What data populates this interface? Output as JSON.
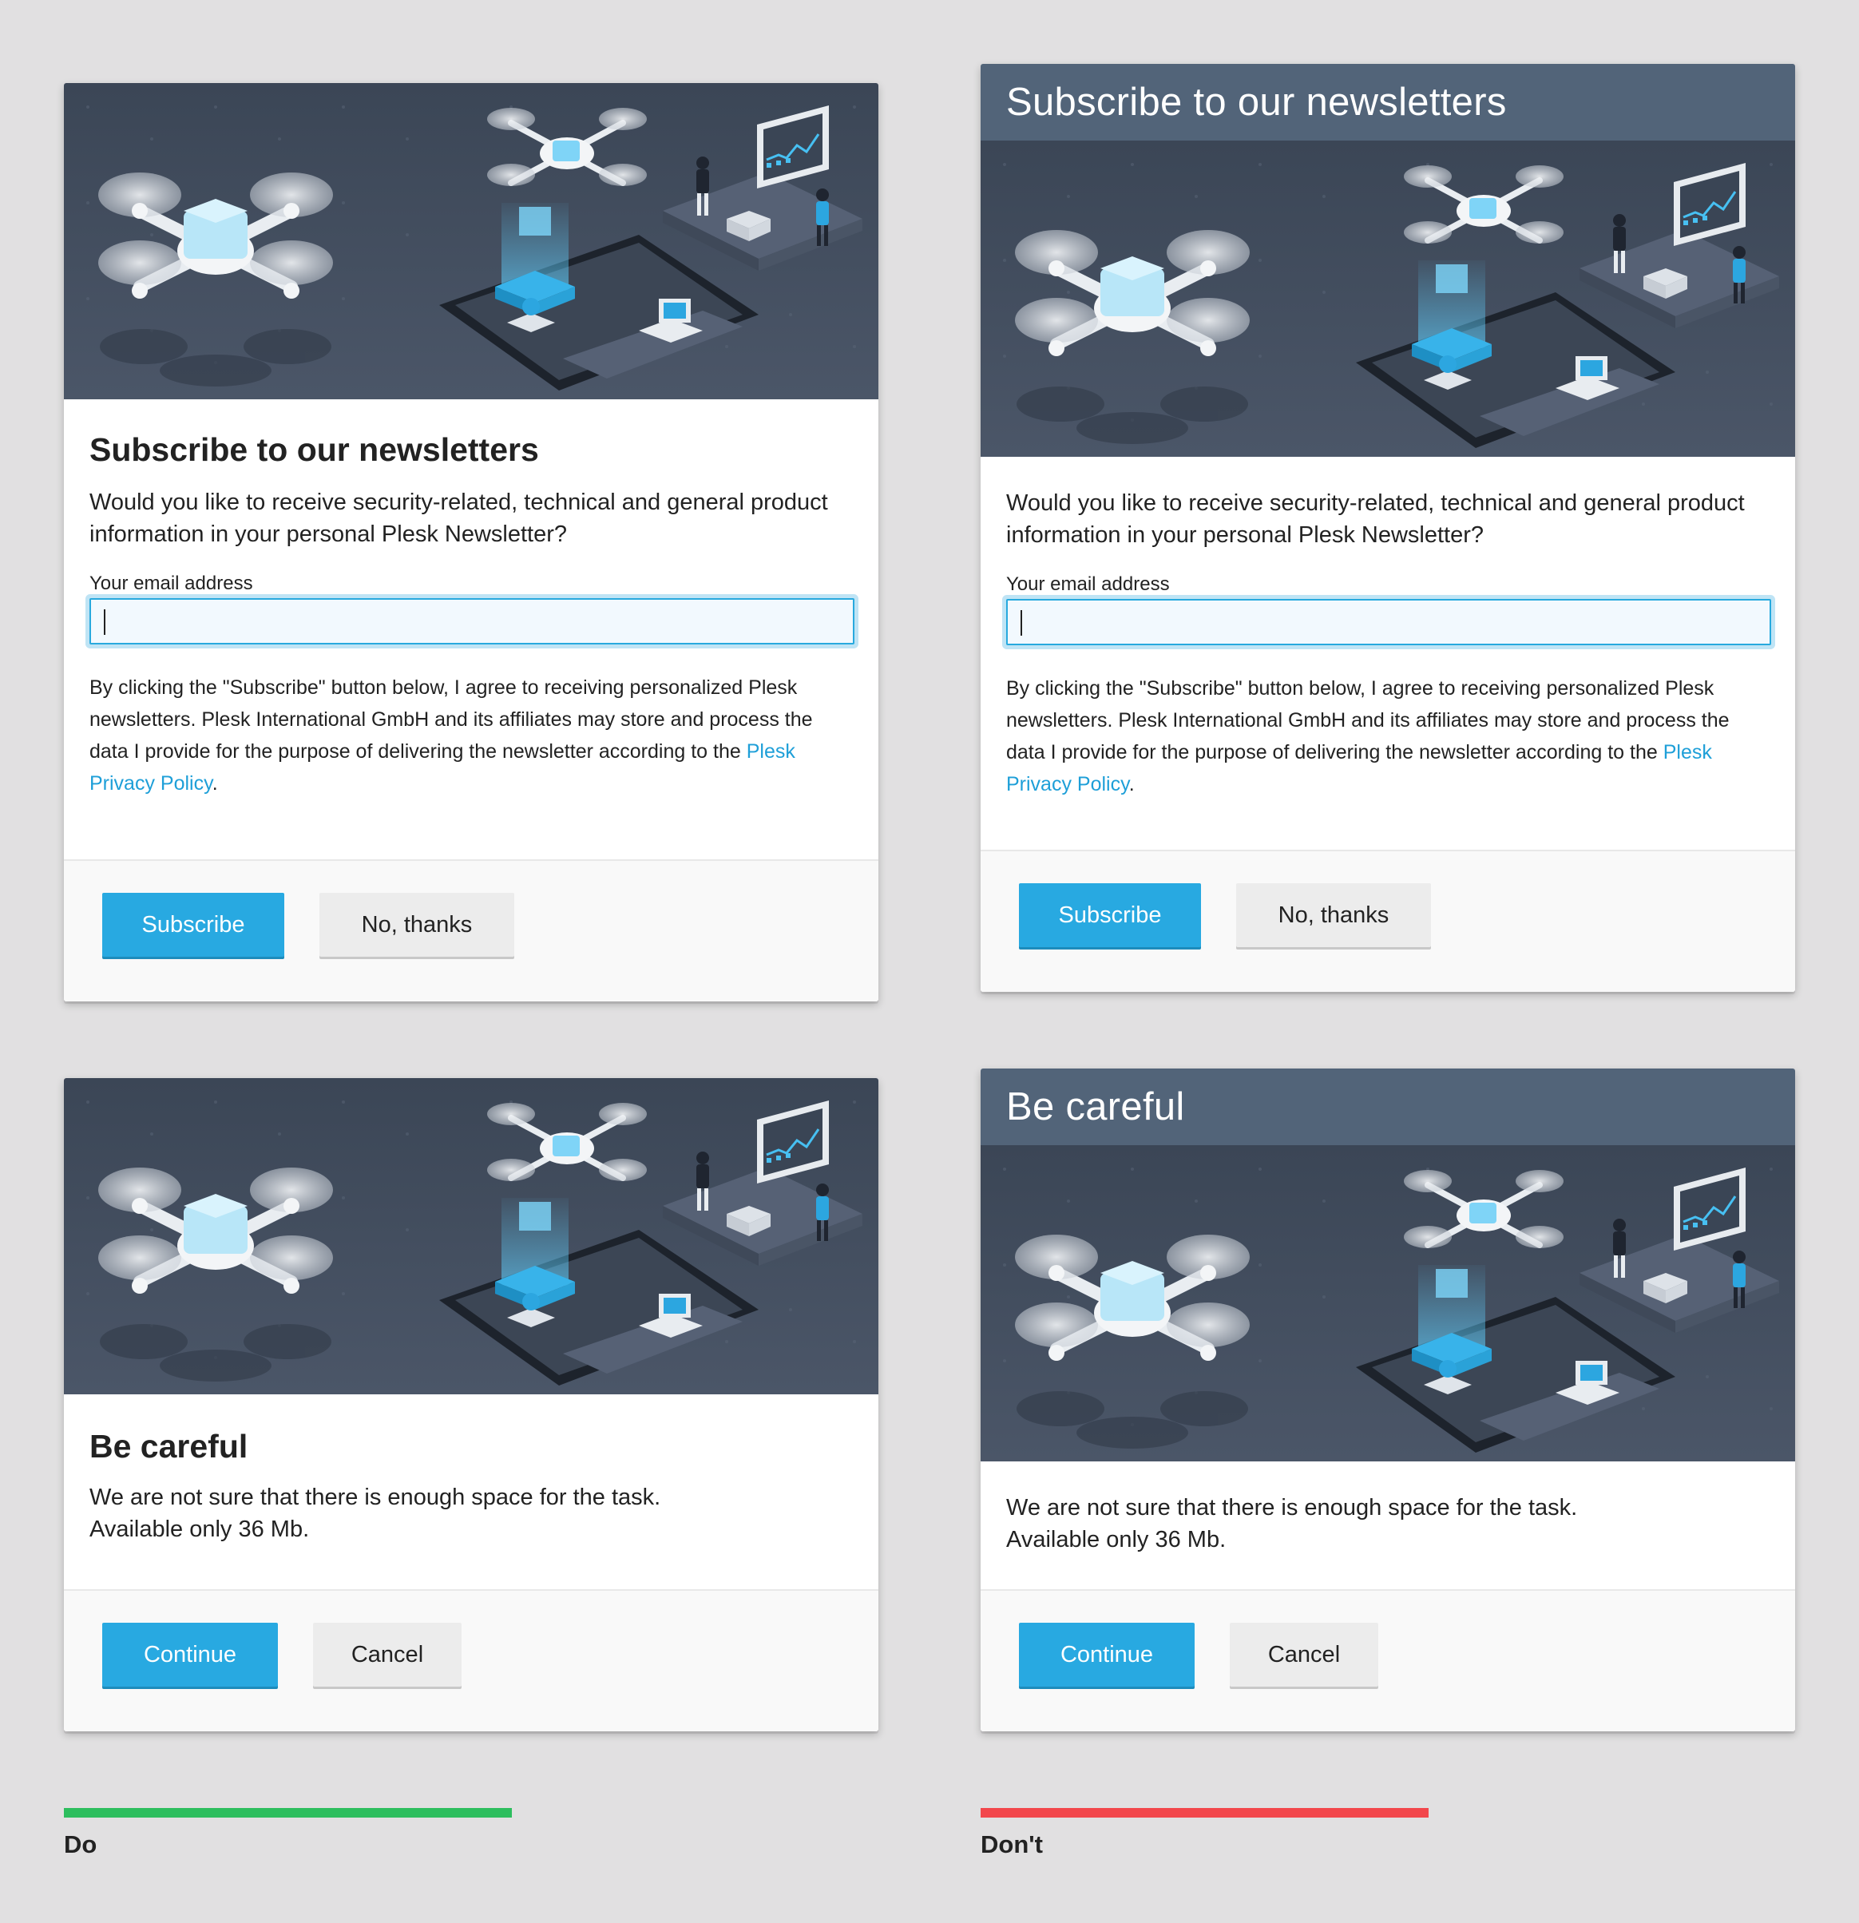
{
  "colors": {
    "page_background": "#e1e0e1",
    "title_bar": "#526479",
    "primary": "#28a9e1",
    "link": "#1e9fd8",
    "do_marker": "#2dbe5e",
    "dont_marker": "#f2474c"
  },
  "newsletter": {
    "title": "Subscribe to our newsletters",
    "question": "Would you like to receive security-related, technical and general product information in your personal Plesk Newsletter?",
    "email_label": "Your email address",
    "email_value": "",
    "consent_text": "By clicking the \"Subscribe\" button below, I agree to receiving personalized Plesk newsletters. Plesk International GmbH and its affiliates may store and process the data I provide for the purpose of delivering the newsletter according to the ",
    "privacy_link": "Plesk Privacy Policy",
    "consent_end": ".",
    "subscribe_label": "Subscribe",
    "decline_label": "No, thanks"
  },
  "warning": {
    "title": "Be careful",
    "line1": "We are not sure that there is enough space for the task.",
    "line2": "Available only 36 Mb.",
    "continue_label": "Continue",
    "cancel_label": "Cancel"
  },
  "examples": {
    "do_label": "Do",
    "dont_label": "Don't"
  },
  "illustration": {
    "icon": "drone-delivery-illustration"
  }
}
